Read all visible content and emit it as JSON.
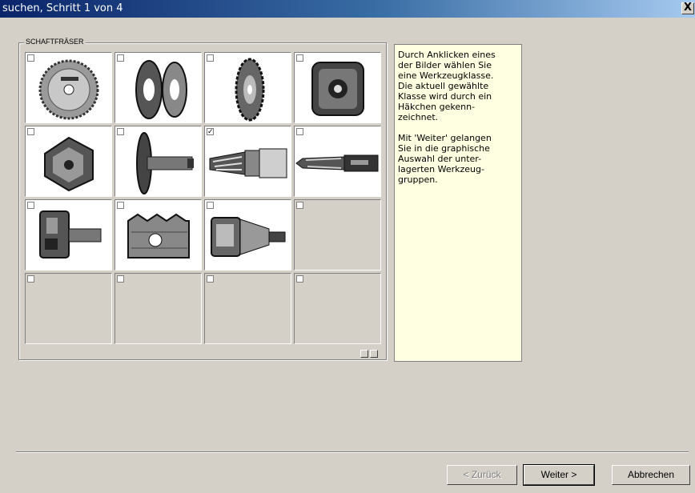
{
  "window": {
    "title": "suchen, Schritt 1 von 4",
    "close_glyph": "X"
  },
  "group": {
    "label": "SCHAFTFRÄSER"
  },
  "tiles": [
    {
      "icon": "circular-saw-blade-icon",
      "checked": false,
      "empty": false
    },
    {
      "icon": "cutter-discs-icon",
      "checked": false,
      "empty": false
    },
    {
      "icon": "toothed-cutter-icon",
      "checked": false,
      "empty": false
    },
    {
      "icon": "cutter-head-icon",
      "checked": false,
      "empty": false
    },
    {
      "icon": "profile-cutter-icon",
      "checked": false,
      "empty": false
    },
    {
      "icon": "shank-disc-cutter-icon",
      "checked": false,
      "empty": false
    },
    {
      "icon": "shank-end-mill-icon",
      "checked": true,
      "empty": false
    },
    {
      "icon": "drill-bit-icon",
      "checked": false,
      "empty": false
    },
    {
      "icon": "insert-cutter-icon",
      "checked": false,
      "empty": false
    },
    {
      "icon": "profile-roller-icon",
      "checked": false,
      "empty": false
    },
    {
      "icon": "tool-holder-icon",
      "checked": false,
      "empty": false
    },
    {
      "icon": "",
      "checked": false,
      "empty": true
    },
    {
      "icon": "",
      "checked": false,
      "empty": true
    },
    {
      "icon": "",
      "checked": false,
      "empty": true
    },
    {
      "icon": "",
      "checked": false,
      "empty": true
    },
    {
      "icon": "",
      "checked": false,
      "empty": true
    }
  ],
  "checkmark_glyph": "✓",
  "info_text": "Durch Anklicken eines\nder Bilder wählen Sie\neine Werkzeugklasse.\nDie aktuell gewählte\nKlasse wird durch ein\nHäkchen gekenn-\nzeichnet.\n\nMit 'Weiter' gelangen\nSie in die graphische\nAuswahl der unter-\nlagerten Werkzeug-\ngruppen.",
  "buttons": {
    "back": "< Zurück",
    "next": "Weiter >",
    "cancel": "Abbrechen"
  }
}
